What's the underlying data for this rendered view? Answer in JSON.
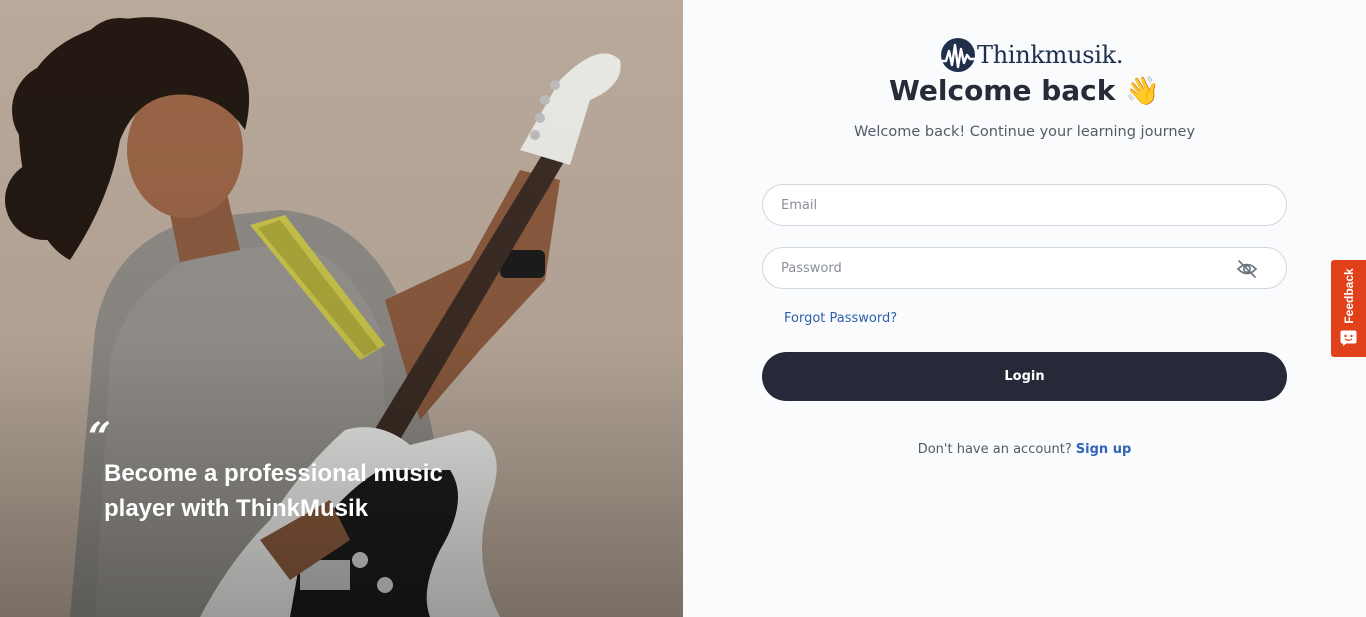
{
  "brand": {
    "name": "Thinkmusik.",
    "primary_color": "#262938",
    "logo_color": "#1f2f4c",
    "link_color": "#2f64b8"
  },
  "hero": {
    "quote_mark": "“",
    "caption": "Become a professional music player with ThinkMusik"
  },
  "form": {
    "title": "Welcome back 👋",
    "subtitle": "Welcome back! Continue your learning journey",
    "email": {
      "placeholder": "Email",
      "value": ""
    },
    "password": {
      "placeholder": "Password",
      "value": "",
      "toggle_icon": "eye-slash-icon"
    },
    "forgot_label": "Forgot Password?",
    "login_label": "Login",
    "signup_prompt": "Don't have an account?",
    "signup_label": "Sign up"
  },
  "feedback": {
    "label": "Feedback",
    "color": "#e0401a",
    "icon": "chat-face-icon"
  }
}
